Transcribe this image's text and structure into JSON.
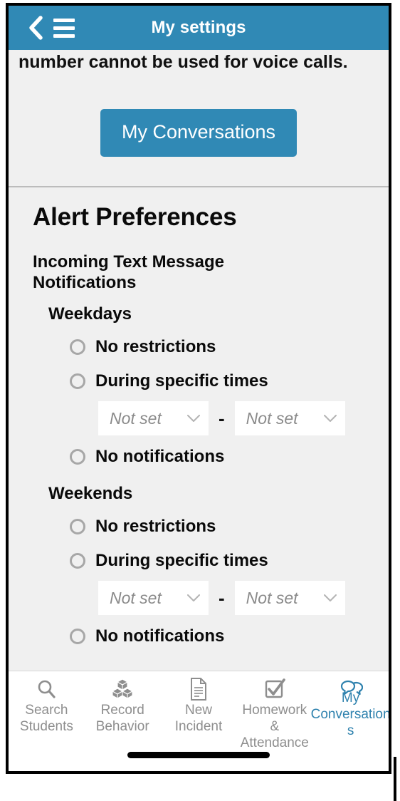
{
  "appbar": {
    "title": "My settings",
    "back_icon": "chevron-left-icon",
    "menu_icon": "hamburger-menu-icon",
    "background_color": "#3089b5"
  },
  "content": {
    "clipped_note": "number cannot be used for voice calls.",
    "conversations_button": "My Conversations"
  },
  "alert_preferences": {
    "title": "Alert Preferences",
    "group_title": "Incoming Text Message Notifications",
    "dash": "-",
    "sections": [
      {
        "name": "Weekdays",
        "options": [
          {
            "label": "No restrictions",
            "selected": false
          },
          {
            "label": "During specific times",
            "selected": false
          },
          {
            "label": "No notifications",
            "selected": false
          }
        ],
        "time_range": {
          "start": "Not set",
          "end": "Not set"
        }
      },
      {
        "name": "Weekends",
        "options": [
          {
            "label": "No restrictions",
            "selected": false
          },
          {
            "label": "During specific times",
            "selected": false
          },
          {
            "label": "No notifications",
            "selected": false
          }
        ],
        "time_range": {
          "start": "Not set",
          "end": "Not set"
        }
      }
    ]
  },
  "tabbar": {
    "active_color": "#2f82ae",
    "inactive_color": "#8e8e8e",
    "tabs": [
      {
        "label": "Search Students",
        "icon": "magnifier-icon",
        "active": false
      },
      {
        "label": "Record Behavior",
        "icon": "cubes-icon",
        "active": false
      },
      {
        "label": "New Incident",
        "icon": "document-icon",
        "active": false
      },
      {
        "label": "Homework & Attendance",
        "icon": "checkbox-checked-icon",
        "active": false
      },
      {
        "label": "My Conversations",
        "icon": "speech-bubbles-icon",
        "active": true
      }
    ]
  }
}
